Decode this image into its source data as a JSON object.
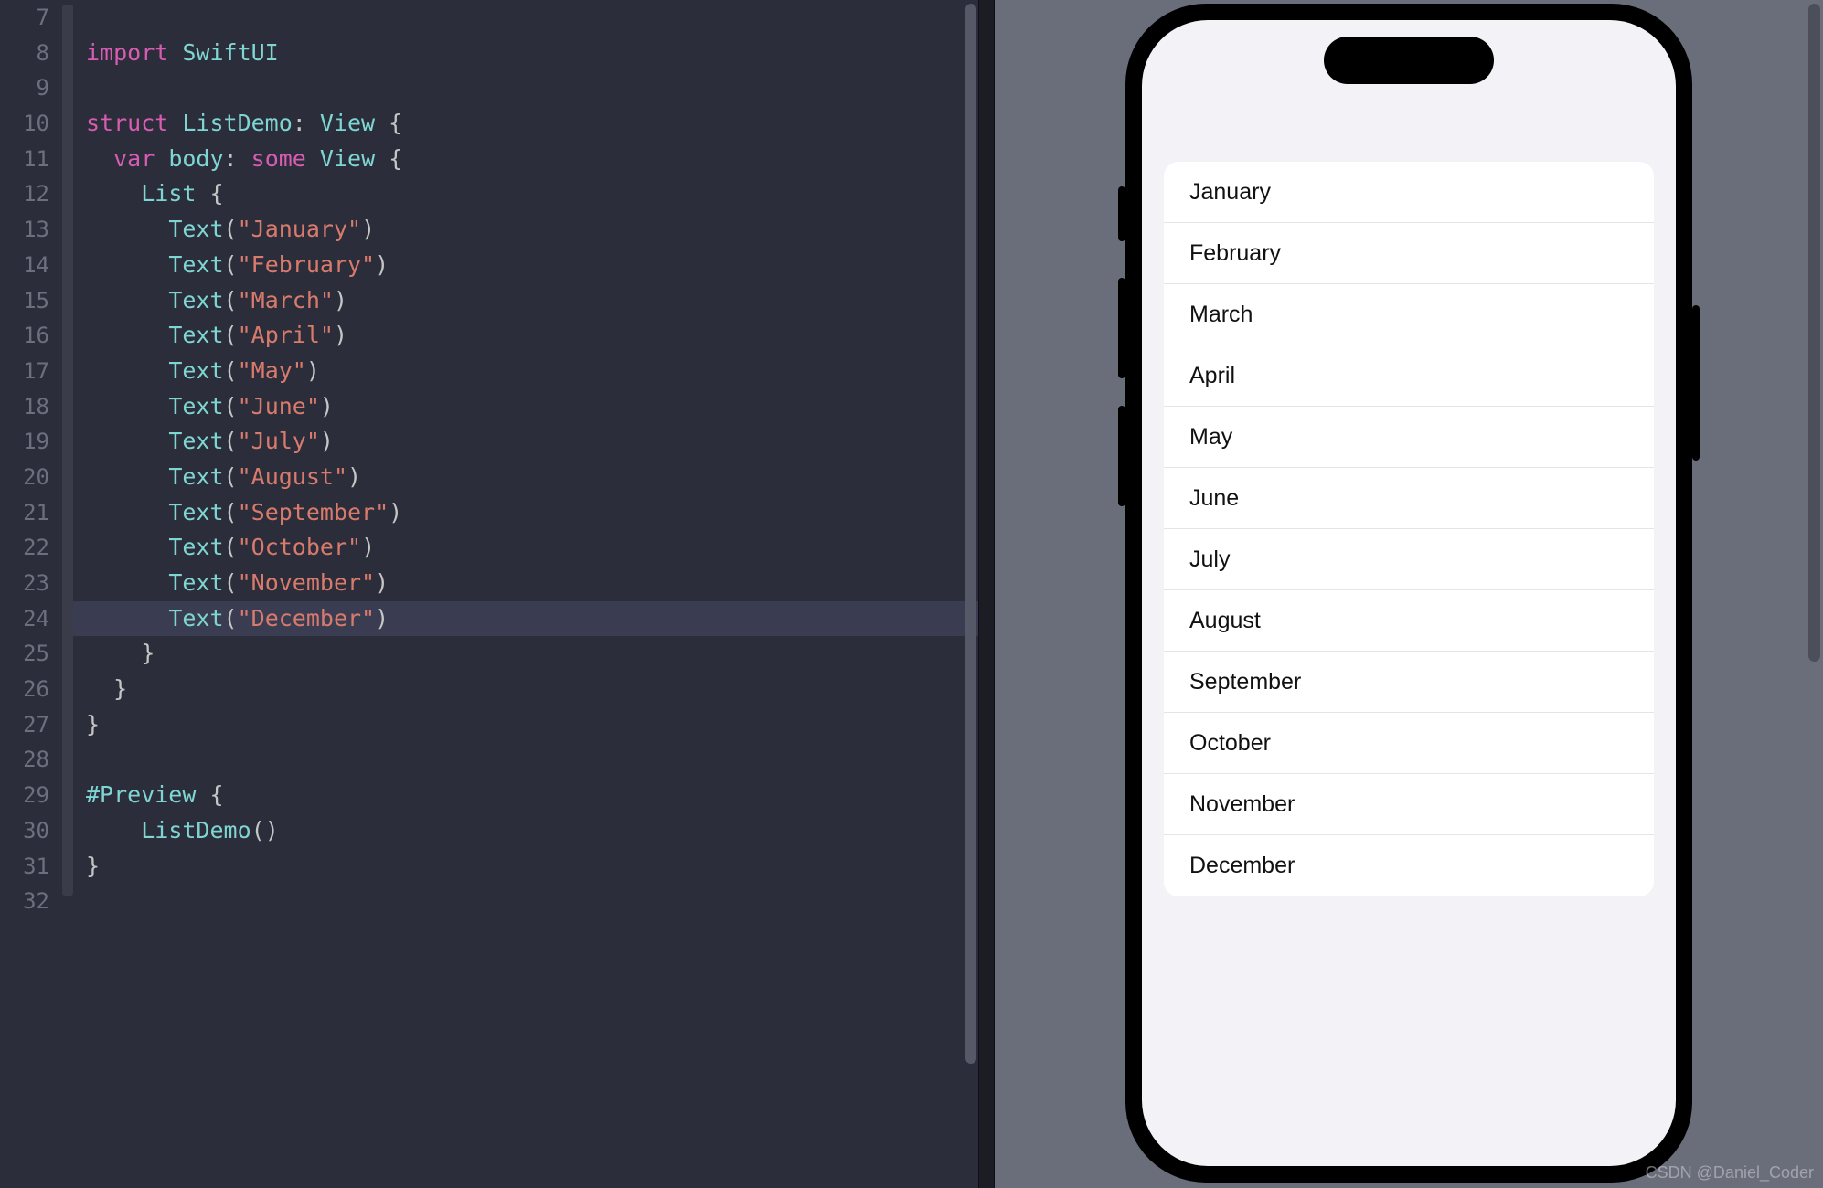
{
  "editor": {
    "highlighted_line": 24,
    "lines": [
      {
        "n": 7,
        "tokens": []
      },
      {
        "n": 8,
        "tokens": [
          {
            "t": "import ",
            "c": "tok-kw"
          },
          {
            "t": "SwiftUI",
            "c": "tok-type"
          }
        ]
      },
      {
        "n": 9,
        "tokens": []
      },
      {
        "n": 10,
        "tokens": [
          {
            "t": "struct ",
            "c": "tok-kw"
          },
          {
            "t": "ListDemo",
            "c": "tok-type"
          },
          {
            "t": ": ",
            "c": "tok-pun"
          },
          {
            "t": "View",
            "c": "tok-type"
          },
          {
            "t": " {",
            "c": "tok-pun"
          }
        ]
      },
      {
        "n": 11,
        "tokens": [
          {
            "t": "  ",
            "c": "tok-plain"
          },
          {
            "t": "var ",
            "c": "tok-kw"
          },
          {
            "t": "body",
            "c": "tok-body"
          },
          {
            "t": ": ",
            "c": "tok-pun"
          },
          {
            "t": "some ",
            "c": "tok-kw"
          },
          {
            "t": "View",
            "c": "tok-type"
          },
          {
            "t": " {",
            "c": "tok-pun"
          }
        ]
      },
      {
        "n": 12,
        "tokens": [
          {
            "t": "    ",
            "c": "tok-plain"
          },
          {
            "t": "List",
            "c": "tok-type"
          },
          {
            "t": " {",
            "c": "tok-pun"
          }
        ]
      },
      {
        "n": 13,
        "tokens": [
          {
            "t": "      ",
            "c": "tok-plain"
          },
          {
            "t": "Text",
            "c": "tok-type"
          },
          {
            "t": "(",
            "c": "tok-pun"
          },
          {
            "t": "\"January\"",
            "c": "tok-str"
          },
          {
            "t": ")",
            "c": "tok-pun"
          }
        ]
      },
      {
        "n": 14,
        "tokens": [
          {
            "t": "      ",
            "c": "tok-plain"
          },
          {
            "t": "Text",
            "c": "tok-type"
          },
          {
            "t": "(",
            "c": "tok-pun"
          },
          {
            "t": "\"February\"",
            "c": "tok-str"
          },
          {
            "t": ")",
            "c": "tok-pun"
          }
        ]
      },
      {
        "n": 15,
        "tokens": [
          {
            "t": "      ",
            "c": "tok-plain"
          },
          {
            "t": "Text",
            "c": "tok-type"
          },
          {
            "t": "(",
            "c": "tok-pun"
          },
          {
            "t": "\"March\"",
            "c": "tok-str"
          },
          {
            "t": ")",
            "c": "tok-pun"
          }
        ]
      },
      {
        "n": 16,
        "tokens": [
          {
            "t": "      ",
            "c": "tok-plain"
          },
          {
            "t": "Text",
            "c": "tok-type"
          },
          {
            "t": "(",
            "c": "tok-pun"
          },
          {
            "t": "\"April\"",
            "c": "tok-str"
          },
          {
            "t": ")",
            "c": "tok-pun"
          }
        ]
      },
      {
        "n": 17,
        "tokens": [
          {
            "t": "      ",
            "c": "tok-plain"
          },
          {
            "t": "Text",
            "c": "tok-type"
          },
          {
            "t": "(",
            "c": "tok-pun"
          },
          {
            "t": "\"May\"",
            "c": "tok-str"
          },
          {
            "t": ")",
            "c": "tok-pun"
          }
        ]
      },
      {
        "n": 18,
        "tokens": [
          {
            "t": "      ",
            "c": "tok-plain"
          },
          {
            "t": "Text",
            "c": "tok-type"
          },
          {
            "t": "(",
            "c": "tok-pun"
          },
          {
            "t": "\"June\"",
            "c": "tok-str"
          },
          {
            "t": ")",
            "c": "tok-pun"
          }
        ]
      },
      {
        "n": 19,
        "tokens": [
          {
            "t": "      ",
            "c": "tok-plain"
          },
          {
            "t": "Text",
            "c": "tok-type"
          },
          {
            "t": "(",
            "c": "tok-pun"
          },
          {
            "t": "\"July\"",
            "c": "tok-str"
          },
          {
            "t": ")",
            "c": "tok-pun"
          }
        ]
      },
      {
        "n": 20,
        "tokens": [
          {
            "t": "      ",
            "c": "tok-plain"
          },
          {
            "t": "Text",
            "c": "tok-type"
          },
          {
            "t": "(",
            "c": "tok-pun"
          },
          {
            "t": "\"August\"",
            "c": "tok-str"
          },
          {
            "t": ")",
            "c": "tok-pun"
          }
        ]
      },
      {
        "n": 21,
        "tokens": [
          {
            "t": "      ",
            "c": "tok-plain"
          },
          {
            "t": "Text",
            "c": "tok-type"
          },
          {
            "t": "(",
            "c": "tok-pun"
          },
          {
            "t": "\"September\"",
            "c": "tok-str"
          },
          {
            "t": ")",
            "c": "tok-pun"
          }
        ]
      },
      {
        "n": 22,
        "tokens": [
          {
            "t": "      ",
            "c": "tok-plain"
          },
          {
            "t": "Text",
            "c": "tok-type"
          },
          {
            "t": "(",
            "c": "tok-pun"
          },
          {
            "t": "\"October\"",
            "c": "tok-str"
          },
          {
            "t": ")",
            "c": "tok-pun"
          }
        ]
      },
      {
        "n": 23,
        "tokens": [
          {
            "t": "      ",
            "c": "tok-plain"
          },
          {
            "t": "Text",
            "c": "tok-type"
          },
          {
            "t": "(",
            "c": "tok-pun"
          },
          {
            "t": "\"November\"",
            "c": "tok-str"
          },
          {
            "t": ")",
            "c": "tok-pun"
          }
        ]
      },
      {
        "n": 24,
        "tokens": [
          {
            "t": "      ",
            "c": "tok-plain"
          },
          {
            "t": "Text",
            "c": "tok-type"
          },
          {
            "t": "(",
            "c": "tok-pun"
          },
          {
            "t": "\"December\"",
            "c": "tok-str"
          },
          {
            "t": ")",
            "c": "tok-pun"
          }
        ]
      },
      {
        "n": 25,
        "tokens": [
          {
            "t": "    }",
            "c": "tok-pun"
          }
        ]
      },
      {
        "n": 26,
        "tokens": [
          {
            "t": "  }",
            "c": "tok-pun"
          }
        ]
      },
      {
        "n": 27,
        "tokens": [
          {
            "t": "}",
            "c": "tok-pun"
          }
        ]
      },
      {
        "n": 28,
        "tokens": []
      },
      {
        "n": 29,
        "tokens": [
          {
            "t": "#Preview",
            "c": "tok-type"
          },
          {
            "t": " {",
            "c": "tok-pun"
          }
        ]
      },
      {
        "n": 30,
        "tokens": [
          {
            "t": "    ",
            "c": "tok-plain"
          },
          {
            "t": "ListDemo",
            "c": "tok-type"
          },
          {
            "t": "()",
            "c": "tok-pun"
          }
        ]
      },
      {
        "n": 31,
        "tokens": [
          {
            "t": "}",
            "c": "tok-pun"
          }
        ]
      },
      {
        "n": 32,
        "tokens": []
      }
    ]
  },
  "preview": {
    "list_items": [
      "January",
      "February",
      "March",
      "April",
      "May",
      "June",
      "July",
      "August",
      "September",
      "October",
      "November",
      "December"
    ]
  },
  "watermark": "CSDN @Daniel_Coder"
}
